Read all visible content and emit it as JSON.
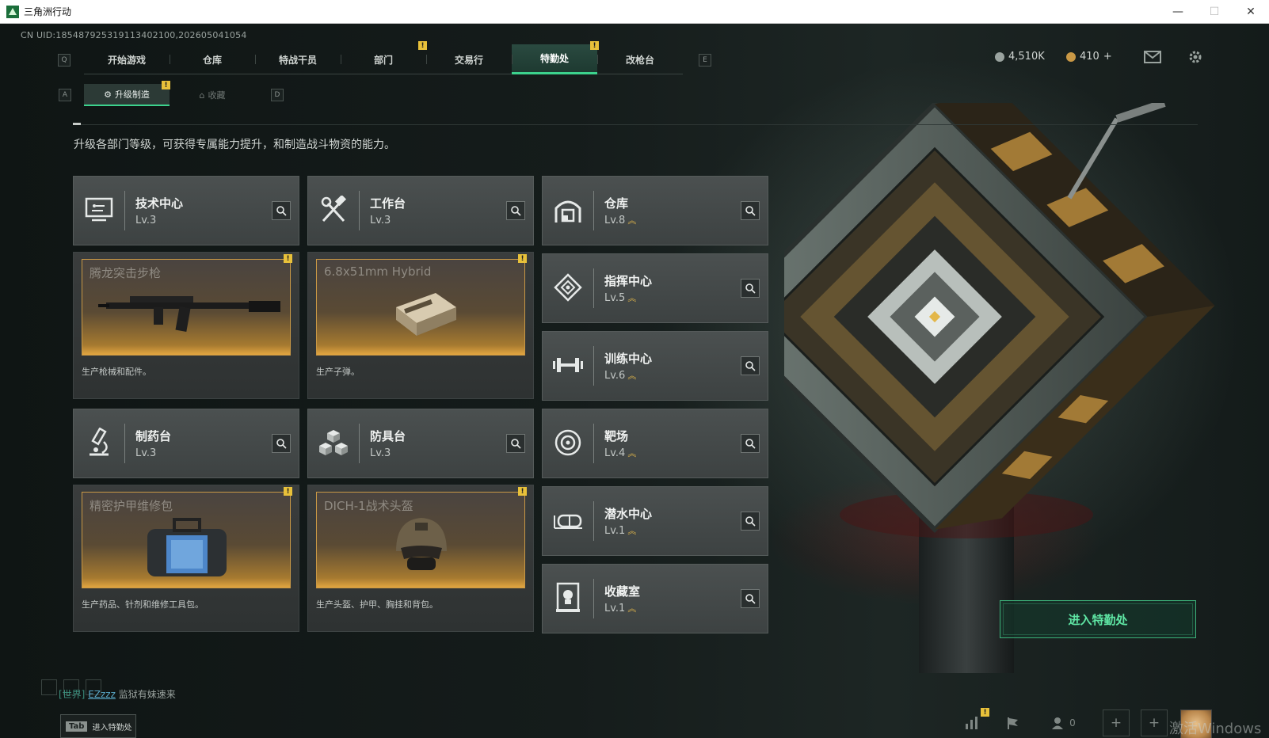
{
  "window": {
    "title": "三角洲行动",
    "minimize": "—",
    "maximize": "☐",
    "close": "✕"
  },
  "uid": "CN UID:1854879253191134021​00,202605041054",
  "nav": {
    "key_left": "Q",
    "key_right": "E",
    "tabs": [
      "开始游戏",
      "仓库",
      "特战干员",
      "部门",
      "交易行",
      "特勤处",
      "改枪台"
    ],
    "active": "特勤处"
  },
  "subnav": {
    "key_left": "A",
    "key_right": "D",
    "tabs": [
      "升级制造",
      "收藏"
    ],
    "active": "升级制造"
  },
  "currency": {
    "coins": "4,510K",
    "tickets": "410",
    "add": "+"
  },
  "description": "升级各部门等级，可获得专属能力提升，和制造战斗物资的能力。",
  "facilities": {
    "tech_center": {
      "name": "技术中心",
      "level": "Lv.3"
    },
    "workbench": {
      "name": "工作台",
      "level": "Lv.3"
    },
    "warehouse": {
      "name": "仓库",
      "level": "Lv.8"
    },
    "command_center": {
      "name": "指挥中心",
      "level": "Lv.5"
    },
    "training_center": {
      "name": "训练中心",
      "level": "Lv.6"
    },
    "pharmacy": {
      "name": "制药台",
      "level": "Lv.3"
    },
    "armor_bench": {
      "name": "防具台",
      "level": "Lv.3"
    },
    "shooting_range": {
      "name": "靶场",
      "level": "Lv.4"
    },
    "diving_center": {
      "name": "潜水中心",
      "level": "Lv.1"
    },
    "collection_room": {
      "name": "收藏室",
      "level": "Lv.1"
    }
  },
  "products": {
    "tech_center": {
      "item": "腾龙突击步枪",
      "desc": "生产枪械和配件。"
    },
    "workbench": {
      "item": "6.8x51mm Hybrid",
      "desc": "生产子弹。"
    },
    "pharmacy": {
      "item": "精密护甲维修包",
      "desc": "生产药品、针剂和维修工具包。"
    },
    "armor_bench": {
      "item": "DICH-1战术头盔",
      "desc": "生产头盔、护甲、胸挂和背包。"
    }
  },
  "enter_button": "进入特勤处",
  "chat": {
    "channel": "[世界]",
    "user": "EZzzz",
    "message": "监狱有妹速来"
  },
  "tab_hint": {
    "key": "Tab",
    "label": "进入特勤处"
  },
  "bottom": {
    "friends_count": "0"
  },
  "watermark": "激活Windows",
  "colors": {
    "accent_green": "#3cd28d",
    "notice_yellow": "#e8c13a",
    "product_gold": "#e2a640"
  }
}
